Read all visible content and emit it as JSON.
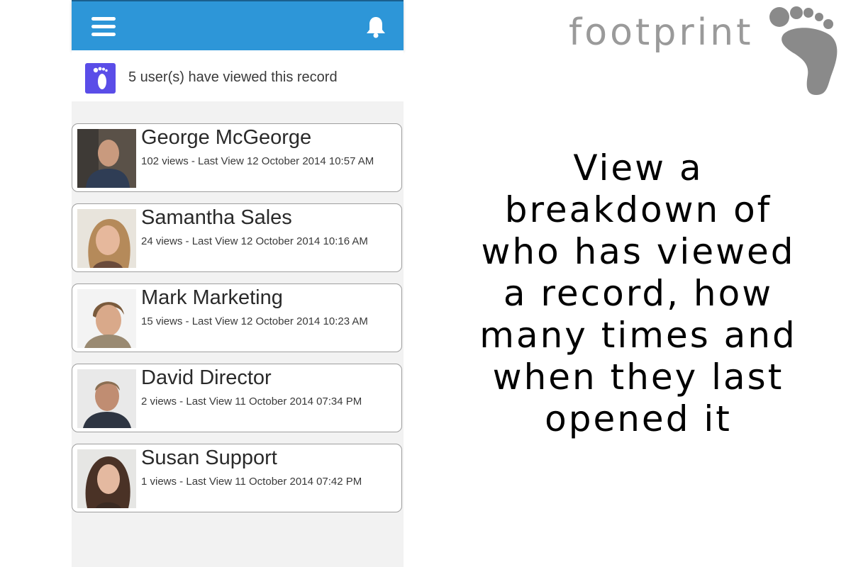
{
  "brand": {
    "name": "footprint",
    "color": "#9a9a9a"
  },
  "app": {
    "accent": "#2d96d8",
    "summary_icon_color": "#5a4de8",
    "header": {
      "menu_icon": "hamburger-icon",
      "notification_icon": "bell-icon"
    },
    "summary": {
      "text": "5 user(s) have viewed this record",
      "icon": "footprint-icon"
    },
    "viewers": [
      {
        "name": "George McGeorge",
        "meta": "102 views - Last View 12 October 2014 10:57 AM"
      },
      {
        "name": "Samantha Sales",
        "meta": "24 views - Last View 12 October 2014 10:16 AM"
      },
      {
        "name": "Mark Marketing",
        "meta": "15 views - Last View 12 October 2014 10:23 AM"
      },
      {
        "name": "David Director",
        "meta": "2 views - Last View 11 October 2014 07:34 PM"
      },
      {
        "name": "Susan Support",
        "meta": "1 views - Last View 11 October 2014 07:42 PM"
      }
    ]
  },
  "tagline": {
    "lines": [
      "View a",
      "breakdown of",
      "who has viewed",
      "a record, how",
      "many times and",
      "when they last",
      "opened it"
    ]
  }
}
